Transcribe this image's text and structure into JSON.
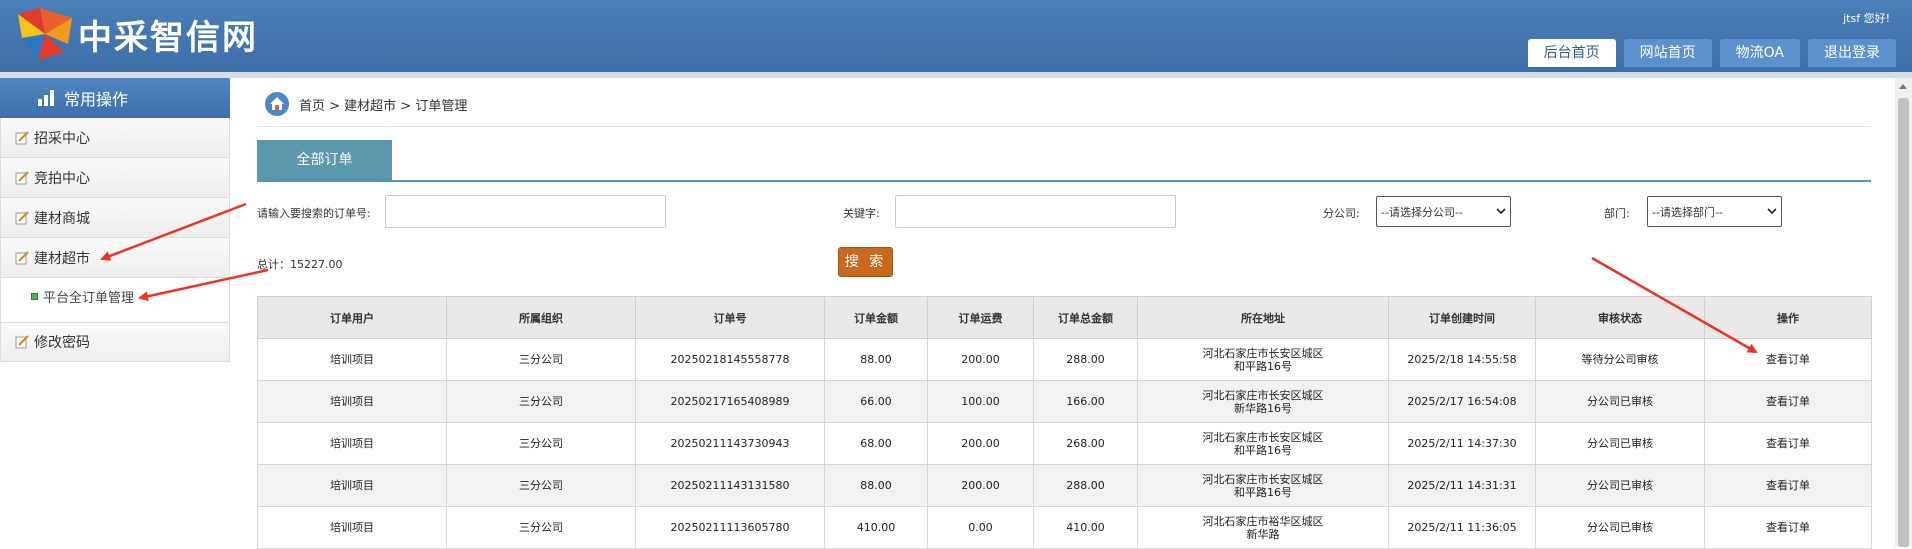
{
  "header": {
    "logo_text": "中采智信网",
    "greeting": "jtsf 您好!",
    "nav": [
      {
        "label": "后台首页",
        "active": true
      },
      {
        "label": "网站首页",
        "active": false
      },
      {
        "label": "物流OA",
        "active": false
      },
      {
        "label": "退出登录",
        "active": false
      }
    ]
  },
  "sidebar": {
    "title": "常用操作",
    "items": [
      {
        "label": "招采中心"
      },
      {
        "label": "竞拍中心"
      },
      {
        "label": "建材商城"
      },
      {
        "label": "建材超市"
      }
    ],
    "sub_item": "平台全订单管理",
    "last_item": "修改密码"
  },
  "breadcrumb": "首页 > 建材超市 > 订单管理",
  "tab": "全部订单",
  "filters": {
    "order_label": "请输入要搜索的订单号:",
    "order_value": "",
    "keyword_label": "关键字:",
    "keyword_value": "",
    "company_label": "分公司:",
    "company_selected": "--请选择分公司--",
    "dept_label": "部门:",
    "dept_selected": "--请选择部门--"
  },
  "total": "总计：15227.00",
  "search_button": "搜 索",
  "table": {
    "headers": [
      "订单用户",
      "所属组织",
      "订单号",
      "订单金额",
      "订单运费",
      "订单总金额",
      "所在地址",
      "订单创建时间",
      "审核状态",
      "操作"
    ],
    "rows": [
      [
        "培训项目",
        "三分公司",
        "20250218145558778",
        "88.00",
        "200.00",
        "288.00",
        "河北石家庄市长安区城区\n和平路16号",
        "2025/2/18 14:55:58",
        "等待分公司审核",
        "查看订单"
      ],
      [
        "培训项目",
        "三分公司",
        "20250217165408989",
        "66.00",
        "100.00",
        "166.00",
        "河北石家庄市长安区城区\n新华路16号",
        "2025/2/17 16:54:08",
        "分公司已审核",
        "查看订单"
      ],
      [
        "培训项目",
        "三分公司",
        "20250211143730943",
        "68.00",
        "200.00",
        "268.00",
        "河北石家庄市长安区城区\n和平路16号",
        "2025/2/11 14:37:30",
        "分公司已审核",
        "查看订单"
      ],
      [
        "培训项目",
        "三分公司",
        "20250211143131580",
        "88.00",
        "200.00",
        "288.00",
        "河北石家庄市长安区城区\n和平路16号",
        "2025/2/11 14:31:31",
        "分公司已审核",
        "查看订单"
      ],
      [
        "培训项目",
        "三分公司",
        "20250211113605780",
        "410.00",
        "0.00",
        "410.00",
        "河北石家庄市裕华区城区\n新华路",
        "2025/2/11 11:36:05",
        "分公司已审核",
        "查看订单"
      ]
    ]
  },
  "colors": {
    "header": "#3c6ea8",
    "tab": "#5b97ad",
    "search_button": "#c8691f",
    "arrow": "#ee3322"
  }
}
